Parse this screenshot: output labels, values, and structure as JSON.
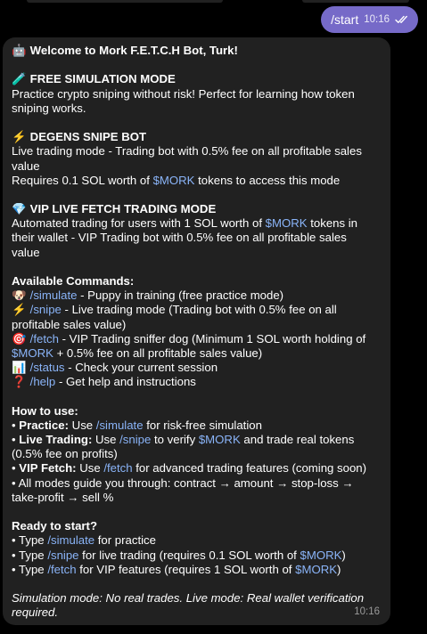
{
  "outgoing": {
    "text": "/start",
    "time": "10:16"
  },
  "message": {
    "time": "10:16",
    "welcome": {
      "emoji": "🤖",
      "text": "Welcome to Mork F.E.T.C.H Bot, Turk!"
    },
    "sim": {
      "emoji": "🧪",
      "title": "FREE SIMULATION MODE",
      "desc1": "Practice crypto sniping without risk! Perfect for learning how token",
      "desc2": "sniping works."
    },
    "degens": {
      "emoji": "⚡",
      "title": "DEGENS SNIPE BOT",
      "desc1": "Live trading mode - Trading bot with 0.5% fee on all profitable sales",
      "desc2": "value",
      "req_pre": "Requires 0.1 SOL worth of ",
      "req_token": "$MORK",
      "req_post": " tokens to access this mode"
    },
    "vip": {
      "emoji": "💎",
      "title": "VIP LIVE FETCH TRADING MODE",
      "desc1_pre": "Automated trading for users with 1 SOL worth of ",
      "desc1_token": "$MORK",
      "desc1_post": " tokens in",
      "desc2": "their wallet - VIP Trading bot with 0.5% fee on all profitable sales",
      "desc3": "value"
    },
    "commands": {
      "heading": "Available Commands:",
      "simulate": {
        "emoji": "🐶",
        "cmd": "/simulate",
        "desc": " - Puppy in training (free practice mode)"
      },
      "snipe": {
        "emoji": "⚡",
        "cmd": "/snipe",
        "desc": " - Live trading mode (Trading bot with 0.5% fee on all",
        "desc2": "profitable sales value)"
      },
      "fetch": {
        "emoji": "🎯",
        "cmd": "/fetch",
        "desc": " - VIP Trading sniffer dog (Minimum 1 SOL worth holding of",
        "desc2_token": "$MORK",
        "desc2_post": " + 0.5% fee on all profitable sales value)"
      },
      "status": {
        "emoji": "📊",
        "cmd": "/status",
        "desc": " - Check your current session"
      },
      "help": {
        "emoji": "❓",
        "cmd": "/help",
        "desc": " - Get help and instructions"
      }
    },
    "howto": {
      "heading": "How to use:",
      "practice_label": "Practice:",
      "practice_pre": " Use ",
      "practice_cmd": "/simulate",
      "practice_post": " for risk-free simulation",
      "live_label": "Live Trading:",
      "live_pre": " Use ",
      "live_cmd": "/snipe",
      "live_mid": " to verify ",
      "live_token": "$MORK",
      "live_post": " and trade real tokens",
      "live_line2": "(0.5% fee on profits)",
      "vip_label": "VIP Fetch:",
      "vip_pre": " Use ",
      "vip_cmd": "/fetch",
      "vip_post": " for advanced trading features (coming soon)",
      "modes_line1": "All modes guide you through: contract → amount → stop-loss →",
      "modes_line2": "take-profit → sell %"
    },
    "ready": {
      "heading": "Ready to start?",
      "l1_pre": "Type ",
      "l1_cmd": "/simulate",
      "l1_post": " for practice",
      "l2_pre": "Type ",
      "l2_cmd": "/snipe",
      "l2_mid": " for live trading (requires 0.1 SOL worth of ",
      "l2_token": "$MORK",
      "l2_post": ")",
      "l3_pre": "Type ",
      "l3_cmd": "/fetch",
      "l3_mid": " for VIP features (requires 1 SOL worth of ",
      "l3_token": "$MORK",
      "l3_post": ")"
    },
    "footer1": "Simulation mode: No real trades. Live mode: Real wallet verification",
    "footer2": "required."
  },
  "colors": {
    "link": "#8ab4f8",
    "bubble_in": "#212121",
    "bubble_out": "#766ac8",
    "background": "#000000"
  }
}
